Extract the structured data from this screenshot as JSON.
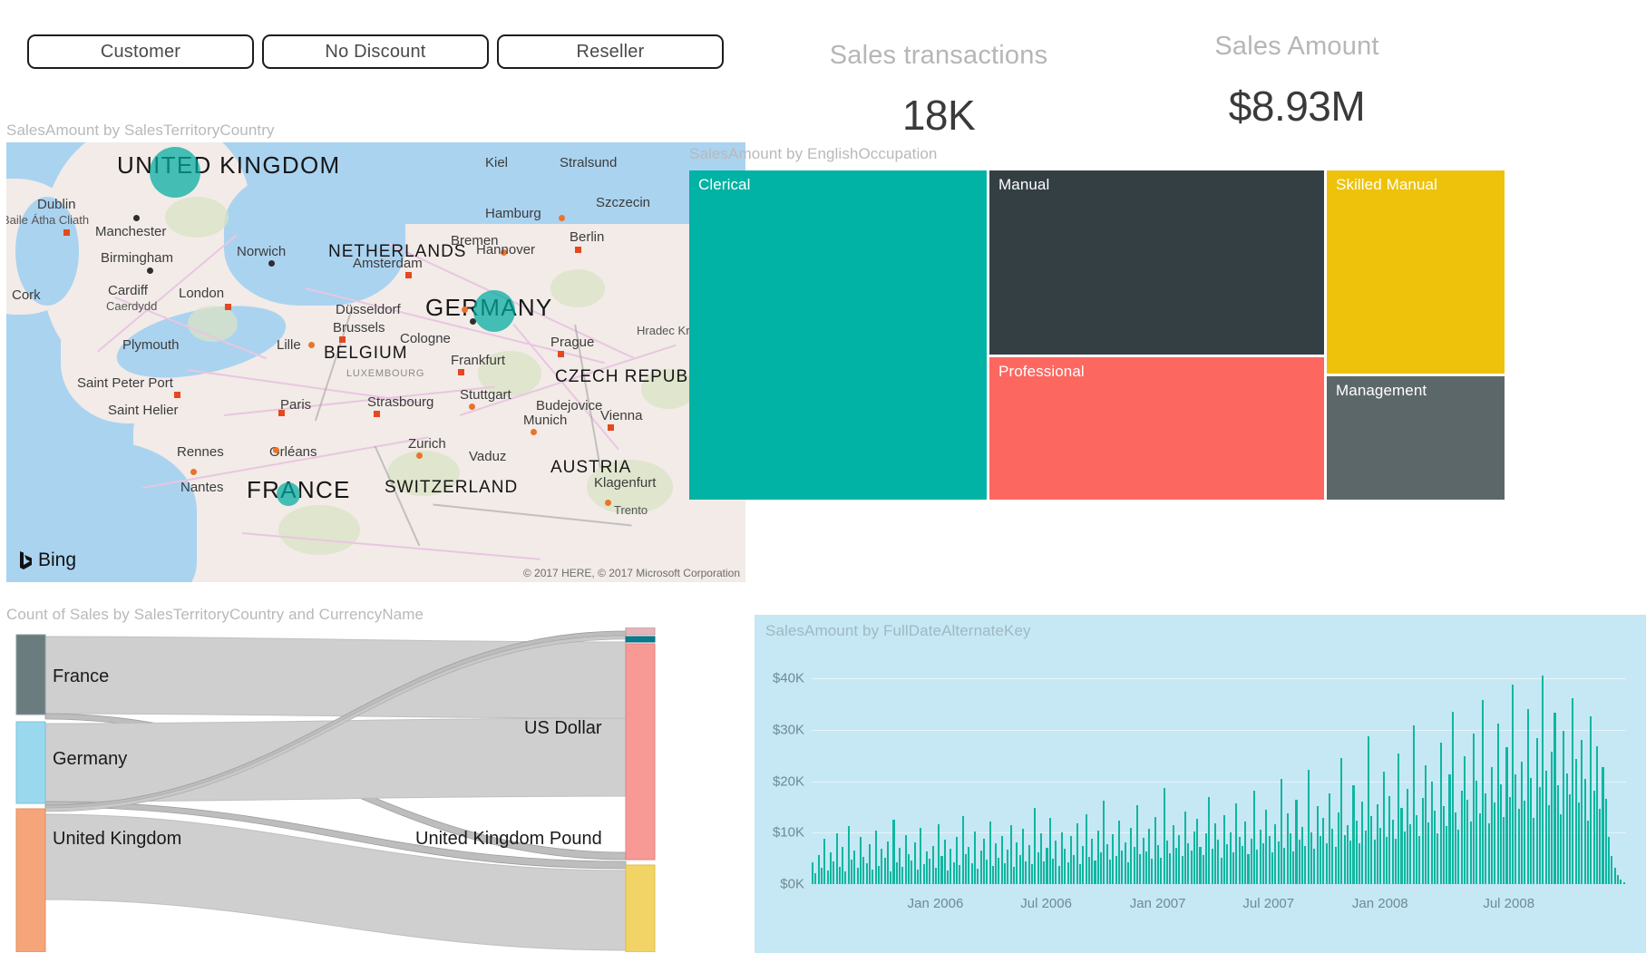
{
  "slicers": [
    {
      "label": "Customer",
      "name": "slicer-customer"
    },
    {
      "label": "No Discount",
      "name": "slicer-no-discount"
    },
    {
      "label": "Reseller",
      "name": "slicer-reseller"
    }
  ],
  "kpis": {
    "transactions": {
      "title": "Sales transactions",
      "value": "18K"
    },
    "amount": {
      "title": "Sales Amount",
      "value": "$8.93M"
    }
  },
  "map": {
    "title": "SalesAmount by SalesTerritoryCountry",
    "provider": "Bing",
    "attribution": "© 2017 HERE, © 2017 Microsoft Corporation",
    "countries": [
      {
        "label": "UNITED KINGDOM"
      },
      {
        "label": "GERMANY"
      },
      {
        "label": "FRANCE"
      },
      {
        "label": "NETHERLANDS"
      },
      {
        "label": "BELGIUM"
      },
      {
        "label": "LUXEMBOURG"
      },
      {
        "label": "SWITZERLAND"
      },
      {
        "label": "AUSTRIA"
      },
      {
        "label": "CZECH REPUBLIC"
      }
    ],
    "cities": [
      "Dublin",
      "Baile Átha Cliath",
      "Cork",
      "Manchester",
      "Birmingham",
      "Cardiff",
      "Caerdydd",
      "London",
      "Norwich",
      "Plymouth",
      "Saint Peter Port",
      "Saint Helier",
      "Rennes",
      "Nantes",
      "Orléans",
      "Paris",
      "Lille",
      "Brussels",
      "Düsseldorf",
      "Cologne",
      "Amsterdam",
      "Bremen",
      "Hamburg",
      "Kiel",
      "Stralsund",
      "Szczecin",
      "Berlin",
      "Hannover",
      "Frankfurt",
      "Strasbourg",
      "Stuttgart",
      "Munich",
      "Zurich",
      "Vaduz",
      "Budejovice",
      "Vienna",
      "Prague",
      "Hradec Králové",
      "Klagenfurt",
      "Trento"
    ],
    "bubbles": [
      {
        "country": "United Kingdom",
        "size": 56
      },
      {
        "country": "Germany",
        "size": 46
      },
      {
        "country": "France",
        "size": 26
      }
    ]
  },
  "treemap": {
    "title": "SalesAmount by EnglishOccupation",
    "cells": [
      {
        "label": "Clerical",
        "color": "#00b3a4",
        "value": 2320000
      },
      {
        "label": "Manual",
        "color": "#343f44",
        "value": 1830000
      },
      {
        "label": "Professional",
        "color": "#fc6760",
        "value": 1540000
      },
      {
        "label": "Skilled Manual",
        "color": "#eec20b",
        "value": 1880000
      },
      {
        "label": "Management",
        "color": "#5c6769",
        "value": 1360000
      }
    ]
  },
  "sankey": {
    "title": "Count of Sales by SalesTerritoryCountry and CurrencyName",
    "sources": [
      {
        "label": "France",
        "color": "#6b7c7e",
        "value": 32
      },
      {
        "label": "Germany",
        "color": "#9ad8ee",
        "value": 30
      },
      {
        "label": "United Kingdom",
        "color": "#f6a57a",
        "value": 38
      }
    ],
    "targets": [
      {
        "label": "",
        "color": "#e3b5bb",
        "value": 2
      },
      {
        "label": "",
        "color": "#0b7c8f",
        "value": 2
      },
      {
        "label": "US Dollar",
        "color": "#f79a96",
        "value": 66
      },
      {
        "label": "United Kingdom Pound",
        "color": "#f2d365",
        "value": 30
      }
    ]
  },
  "chart_data": {
    "type": "bar",
    "title": "SalesAmount by FullDateAlternateKey",
    "xlabel": "",
    "ylabel": "",
    "ylim": [
      0,
      45000
    ],
    "yticks": [
      "$0K",
      "$10K",
      "$20K",
      "$30K",
      "$40K"
    ],
    "ytick_values": [
      0,
      10000,
      20000,
      30000,
      40000
    ],
    "xticks": [
      "Jan 2006",
      "Jul 2006",
      "Jan 2007",
      "Jul 2007",
      "Jan 2008",
      "Jul 2008"
    ],
    "xtick_positions": [
      0.152,
      0.288,
      0.425,
      0.561,
      0.698,
      0.856
    ],
    "grid": true,
    "legend": null,
    "series_color": "#0fb69f",
    "background": "#c5e8f4",
    "x_range": [
      "Aug 2005",
      "Aug 2008"
    ],
    "values": [
      4300,
      2100,
      5600,
      3200,
      8900,
      2700,
      6100,
      4400,
      9800,
      3300,
      7200,
      2500,
      11300,
      4800,
      6600,
      3100,
      9200,
      5300,
      4100,
      7700,
      2900,
      10400,
      3600,
      6900,
      5100,
      8300,
      2400,
      12600,
      4200,
      7100,
      3400,
      9600,
      5800,
      4600,
      8100,
      2800,
      10900,
      3900,
      6300,
      4900,
      7500,
      3100,
      11700,
      5400,
      8700,
      2600,
      6800,
      4300,
      9100,
      3700,
      13200,
      5900,
      7300,
      4100,
      10200,
      3000,
      6500,
      8800,
      4700,
      12100,
      3500,
      7900,
      5200,
      9400,
      4000,
      6700,
      11500,
      3300,
      8200,
      5600,
      10700,
      4400,
      7600,
      3800,
      14800,
      6200,
      9900,
      4500,
      7100,
      12900,
      5000,
      8400,
      3600,
      10100,
      6800,
      4200,
      9300,
      5700,
      11800,
      3900,
      7400,
      13600,
      5300,
      8900,
      4600,
      10500,
      6100,
      16200,
      7800,
      4800,
      9700,
      5500,
      12300,
      6600,
      8100,
      4300,
      11000,
      7200,
      15400,
      5800,
      9000,
      6300,
      10800,
      4900,
      13100,
      7600,
      5200,
      18700,
      8500,
      6000,
      11400,
      7000,
      9600,
      5400,
      14200,
      8000,
      6500,
      10300,
      12700,
      7300,
      5700,
      9800,
      16900,
      6900,
      11900,
      8600,
      5100,
      13400,
      7800,
      10000,
      6200,
      15700,
      9200,
      7400,
      12200,
      5900,
      8800,
      18100,
      6700,
      10600,
      7900,
      14500,
      9400,
      6100,
      11600,
      8300,
      20400,
      7100,
      13800,
      9900,
      6400,
      16500,
      8700,
      11200,
      7500,
      22300,
      10100,
      6800,
      15100,
      9300,
      12800,
      8000,
      17700,
      10800,
      7200,
      14000,
      24600,
      9600,
      11500,
      8400,
      19300,
      12400,
      7900,
      16100,
      10400,
      28700,
      13200,
      8600,
      15600,
      11000,
      21800,
      9100,
      17200,
      12600,
      8900,
      25400,
      14800,
      10200,
      18600,
      11700,
      30900,
      13500,
      9400,
      16800,
      23100,
      12000,
      19900,
      14300,
      9800,
      27500,
      15200,
      11300,
      21400,
      33600,
      13900,
      10600,
      18200,
      24800,
      16400,
      12100,
      29300,
      20100,
      13700,
      35800,
      17600,
      11900,
      22700,
      15800,
      31200,
      19400,
      13100,
      26600,
      17000,
      38900,
      21300,
      14600,
      23900,
      16200,
      34100,
      20700,
      12800,
      28400,
      18800,
      40600,
      22100,
      15400,
      25700,
      33400,
      19200,
      13600,
      29800,
      21600,
      17400,
      36200,
      24300,
      15900,
      28100,
      20400,
      12300,
      32700,
      18100,
      26900,
      14700,
      22800,
      16600,
      9200,
      5400,
      3100,
      1800,
      900,
      400
    ]
  }
}
